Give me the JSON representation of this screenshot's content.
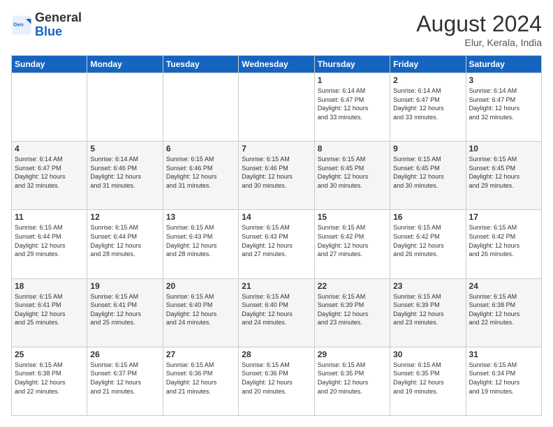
{
  "header": {
    "logo_general": "General",
    "logo_blue": "Blue",
    "title": "August 2024",
    "subtitle": "Elur, Kerala, India"
  },
  "days_of_week": [
    "Sunday",
    "Monday",
    "Tuesday",
    "Wednesday",
    "Thursday",
    "Friday",
    "Saturday"
  ],
  "weeks": [
    [
      {
        "day": "",
        "info": ""
      },
      {
        "day": "",
        "info": ""
      },
      {
        "day": "",
        "info": ""
      },
      {
        "day": "",
        "info": ""
      },
      {
        "day": "1",
        "info": "Sunrise: 6:14 AM\nSunset: 6:47 PM\nDaylight: 12 hours\nand 33 minutes."
      },
      {
        "day": "2",
        "info": "Sunrise: 6:14 AM\nSunset: 6:47 PM\nDaylight: 12 hours\nand 33 minutes."
      },
      {
        "day": "3",
        "info": "Sunrise: 6:14 AM\nSunset: 6:47 PM\nDaylight: 12 hours\nand 32 minutes."
      }
    ],
    [
      {
        "day": "4",
        "info": "Sunrise: 6:14 AM\nSunset: 6:47 PM\nDaylight: 12 hours\nand 32 minutes."
      },
      {
        "day": "5",
        "info": "Sunrise: 6:14 AM\nSunset: 6:46 PM\nDaylight: 12 hours\nand 31 minutes."
      },
      {
        "day": "6",
        "info": "Sunrise: 6:15 AM\nSunset: 6:46 PM\nDaylight: 12 hours\nand 31 minutes."
      },
      {
        "day": "7",
        "info": "Sunrise: 6:15 AM\nSunset: 6:46 PM\nDaylight: 12 hours\nand 30 minutes."
      },
      {
        "day": "8",
        "info": "Sunrise: 6:15 AM\nSunset: 6:45 PM\nDaylight: 12 hours\nand 30 minutes."
      },
      {
        "day": "9",
        "info": "Sunrise: 6:15 AM\nSunset: 6:45 PM\nDaylight: 12 hours\nand 30 minutes."
      },
      {
        "day": "10",
        "info": "Sunrise: 6:15 AM\nSunset: 6:45 PM\nDaylight: 12 hours\nand 29 minutes."
      }
    ],
    [
      {
        "day": "11",
        "info": "Sunrise: 6:15 AM\nSunset: 6:44 PM\nDaylight: 12 hours\nand 29 minutes."
      },
      {
        "day": "12",
        "info": "Sunrise: 6:15 AM\nSunset: 6:44 PM\nDaylight: 12 hours\nand 28 minutes."
      },
      {
        "day": "13",
        "info": "Sunrise: 6:15 AM\nSunset: 6:43 PM\nDaylight: 12 hours\nand 28 minutes."
      },
      {
        "day": "14",
        "info": "Sunrise: 6:15 AM\nSunset: 6:43 PM\nDaylight: 12 hours\nand 27 minutes."
      },
      {
        "day": "15",
        "info": "Sunrise: 6:15 AM\nSunset: 6:42 PM\nDaylight: 12 hours\nand 27 minutes."
      },
      {
        "day": "16",
        "info": "Sunrise: 6:15 AM\nSunset: 6:42 PM\nDaylight: 12 hours\nand 26 minutes."
      },
      {
        "day": "17",
        "info": "Sunrise: 6:15 AM\nSunset: 6:42 PM\nDaylight: 12 hours\nand 26 minutes."
      }
    ],
    [
      {
        "day": "18",
        "info": "Sunrise: 6:15 AM\nSunset: 6:41 PM\nDaylight: 12 hours\nand 25 minutes."
      },
      {
        "day": "19",
        "info": "Sunrise: 6:15 AM\nSunset: 6:41 PM\nDaylight: 12 hours\nand 25 minutes."
      },
      {
        "day": "20",
        "info": "Sunrise: 6:15 AM\nSunset: 6:40 PM\nDaylight: 12 hours\nand 24 minutes."
      },
      {
        "day": "21",
        "info": "Sunrise: 6:15 AM\nSunset: 6:40 PM\nDaylight: 12 hours\nand 24 minutes."
      },
      {
        "day": "22",
        "info": "Sunrise: 6:15 AM\nSunset: 6:39 PM\nDaylight: 12 hours\nand 23 minutes."
      },
      {
        "day": "23",
        "info": "Sunrise: 6:15 AM\nSunset: 6:39 PM\nDaylight: 12 hours\nand 23 minutes."
      },
      {
        "day": "24",
        "info": "Sunrise: 6:15 AM\nSunset: 6:38 PM\nDaylight: 12 hours\nand 22 minutes."
      }
    ],
    [
      {
        "day": "25",
        "info": "Sunrise: 6:15 AM\nSunset: 6:38 PM\nDaylight: 12 hours\nand 22 minutes."
      },
      {
        "day": "26",
        "info": "Sunrise: 6:15 AM\nSunset: 6:37 PM\nDaylight: 12 hours\nand 21 minutes."
      },
      {
        "day": "27",
        "info": "Sunrise: 6:15 AM\nSunset: 6:36 PM\nDaylight: 12 hours\nand 21 minutes."
      },
      {
        "day": "28",
        "info": "Sunrise: 6:15 AM\nSunset: 6:36 PM\nDaylight: 12 hours\nand 20 minutes."
      },
      {
        "day": "29",
        "info": "Sunrise: 6:15 AM\nSunset: 6:35 PM\nDaylight: 12 hours\nand 20 minutes."
      },
      {
        "day": "30",
        "info": "Sunrise: 6:15 AM\nSunset: 6:35 PM\nDaylight: 12 hours\nand 19 minutes."
      },
      {
        "day": "31",
        "info": "Sunrise: 6:15 AM\nSunset: 6:34 PM\nDaylight: 12 hours\nand 19 minutes."
      }
    ]
  ]
}
